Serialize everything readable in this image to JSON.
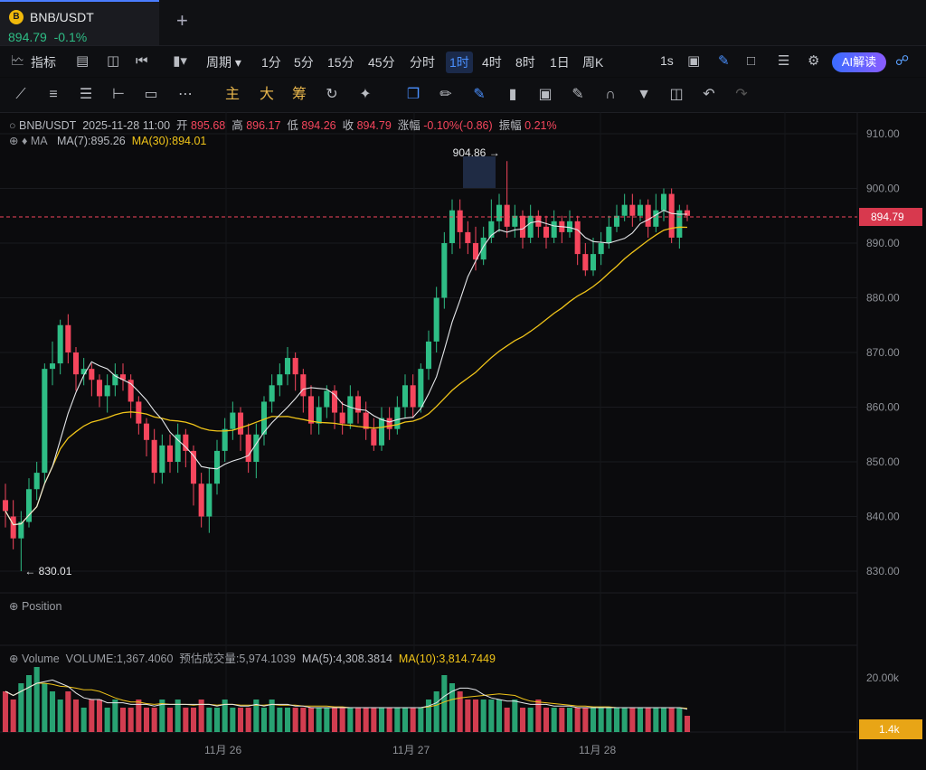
{
  "tab": {
    "symbol": "BNB/USDT",
    "price": "894.79",
    "change": "-0.1%",
    "coin_icon": "bnb-coin-icon",
    "coin_letter": "B"
  },
  "toolbar": {
    "indicators_label": "指标",
    "period_label": "周期",
    "intervals": [
      "1分",
      "5分",
      "15分",
      "45分",
      "分时",
      "1时",
      "4时",
      "8时",
      "1日",
      "周K"
    ],
    "active_interval": "1时",
    "replay_speed": "1s",
    "ai_label": "AI解读"
  },
  "drawing_toolbar": {
    "main": "主",
    "big": "大",
    "chip": "筹"
  },
  "info_bar": {
    "symbol": "BNB/USDT",
    "datetime": "2025-11-28 11:00",
    "open_label": "开",
    "open": "895.68",
    "high_label": "高",
    "high": "896.17",
    "low_label": "低",
    "low": "894.26",
    "close_label": "收",
    "close": "894.79",
    "change_label": "涨幅",
    "change": "-0.10%(-0.86)",
    "amp_label": "振幅",
    "amp": "0.21%"
  },
  "ma_bar": {
    "label": "MA",
    "ma7": "MA(7):895.26",
    "ma30": "MA(30):894.01"
  },
  "position_label": "Position",
  "volume_bar": {
    "label": "Volume",
    "volume": "VOLUME:1,367.4060",
    "est_label": "预估成交量:",
    "est": "5,974.1039",
    "ma5": "MA(5):4,308.3814",
    "ma10": "MA(10):3,814.7449"
  },
  "colors": {
    "up": "#2ebd85",
    "down": "#f6465d",
    "ma7": "#e5e7ea",
    "ma30": "#f0c419",
    "accent": "#4a90ff"
  },
  "chart_data": {
    "type": "candlestick",
    "price_axis": {
      "ticks": [
        "910.00",
        "900.00",
        "890.00",
        "880.00",
        "870.00",
        "860.00",
        "850.00",
        "840.00",
        "830.00"
      ],
      "min": 825,
      "max": 915
    },
    "current_price": "894.79",
    "high_marker": "904.86",
    "low_marker": "830.01",
    "volume_axis": {
      "ticks": [
        "20.00k"
      ],
      "current": "1.4k"
    },
    "date_labels": [
      "11月 26",
      "11月 27",
      "11月 28"
    ],
    "candles": [
      [
        843,
        841,
        846,
        838
      ],
      [
        840,
        836,
        843,
        834
      ],
      [
        836,
        839,
        841,
        830
      ],
      [
        839,
        845,
        847,
        838
      ],
      [
        845,
        848,
        850,
        843
      ],
      [
        848,
        867,
        868,
        846
      ],
      [
        867,
        868,
        872,
        864
      ],
      [
        868,
        875,
        876,
        866
      ],
      [
        875,
        870,
        877,
        868
      ],
      [
        870,
        866,
        871,
        863
      ],
      [
        866,
        867,
        869,
        864
      ],
      [
        867,
        865,
        868,
        862
      ],
      [
        865,
        862,
        866,
        860
      ],
      [
        862,
        864,
        866,
        859
      ],
      [
        864,
        866,
        868,
        862
      ],
      [
        866,
        865,
        868,
        863
      ],
      [
        865,
        861,
        866,
        858
      ],
      [
        861,
        857,
        862,
        855
      ],
      [
        857,
        854,
        858,
        851
      ],
      [
        854,
        848,
        856,
        846
      ],
      [
        848,
        853,
        855,
        846
      ],
      [
        853,
        850,
        855,
        848
      ],
      [
        850,
        855,
        857,
        848
      ],
      [
        855,
        852,
        856,
        849
      ],
      [
        852,
        846,
        853,
        842
      ],
      [
        846,
        840,
        848,
        838
      ],
      [
        840,
        846,
        849,
        837
      ],
      [
        846,
        852,
        854,
        844
      ],
      [
        852,
        856,
        858,
        850
      ],
      [
        856,
        859,
        861,
        854
      ],
      [
        859,
        855,
        860,
        852
      ],
      [
        855,
        850,
        857,
        848
      ],
      [
        850,
        855,
        857,
        847
      ],
      [
        855,
        861,
        862,
        853
      ],
      [
        861,
        864,
        866,
        859
      ],
      [
        864,
        866,
        868,
        862
      ],
      [
        866,
        869,
        871,
        864
      ],
      [
        869,
        866,
        870,
        863
      ],
      [
        866,
        862,
        867,
        859
      ],
      [
        862,
        857,
        864,
        855
      ],
      [
        857,
        860,
        862,
        855
      ],
      [
        860,
        863,
        864,
        858
      ],
      [
        863,
        859,
        864,
        856
      ],
      [
        859,
        857,
        861,
        855
      ],
      [
        857,
        862,
        864,
        856
      ],
      [
        862,
        859,
        863,
        857
      ],
      [
        859,
        856,
        861,
        854
      ],
      [
        856,
        853,
        858,
        852
      ],
      [
        853,
        858,
        860,
        852
      ],
      [
        858,
        856,
        860,
        854
      ],
      [
        856,
        860,
        862,
        855
      ],
      [
        860,
        864,
        866,
        858
      ],
      [
        864,
        860,
        866,
        858
      ],
      [
        860,
        867,
        868,
        859
      ],
      [
        867,
        872,
        874,
        865
      ],
      [
        872,
        880,
        882,
        870
      ],
      [
        880,
        890,
        892,
        878
      ],
      [
        890,
        896,
        898,
        888
      ],
      [
        896,
        892,
        898,
        889
      ],
      [
        892,
        890,
        894,
        888
      ],
      [
        890,
        887,
        893,
        885
      ],
      [
        887,
        891,
        893,
        886
      ],
      [
        891,
        894,
        898,
        890
      ],
      [
        894,
        897,
        899,
        892
      ],
      [
        897,
        893,
        905,
        891
      ],
      [
        893,
        895,
        897,
        891
      ],
      [
        895,
        891,
        896,
        889
      ],
      [
        891,
        895,
        897,
        890
      ],
      [
        895,
        893,
        896,
        891
      ],
      [
        893,
        891,
        895,
        889
      ],
      [
        891,
        894,
        896,
        890
      ],
      [
        894,
        892,
        895,
        890
      ],
      [
        892,
        894,
        896,
        891
      ],
      [
        894,
        888,
        895,
        886
      ],
      [
        888,
        885,
        890,
        884
      ],
      [
        885,
        888,
        891,
        884
      ],
      [
        888,
        890,
        892,
        886
      ],
      [
        890,
        893,
        895,
        889
      ],
      [
        893,
        895,
        897,
        892
      ],
      [
        895,
        897,
        899,
        894
      ],
      [
        897,
        895,
        899,
        893
      ],
      [
        895,
        897,
        898,
        894
      ],
      [
        897,
        893,
        898,
        891
      ],
      [
        893,
        896,
        899,
        892
      ],
      [
        896,
        899,
        900,
        894
      ],
      [
        899,
        891,
        900,
        890
      ],
      [
        891,
        896,
        897,
        889
      ],
      [
        896,
        895,
        897,
        894
      ]
    ],
    "volumes": [
      5,
      4,
      6,
      7,
      8,
      6,
      5,
      4,
      5,
      4,
      3,
      4,
      4,
      3,
      4,
      3,
      3,
      4,
      3,
      3,
      4,
      3,
      4,
      3,
      3,
      4,
      3,
      3,
      4,
      3,
      3,
      3,
      4,
      3,
      4,
      3,
      3,
      3,
      3,
      3,
      3,
      3,
      3,
      3,
      3,
      3,
      3,
      3,
      3,
      3,
      3,
      3,
      3,
      3,
      4,
      5,
      7,
      6,
      5,
      4,
      4,
      4,
      4,
      4,
      3,
      4,
      3,
      3,
      4,
      3,
      3,
      3,
      3,
      3,
      3,
      3,
      3,
      3,
      3,
      3,
      3,
      3,
      3,
      3,
      3,
      3,
      3,
      2
    ]
  }
}
